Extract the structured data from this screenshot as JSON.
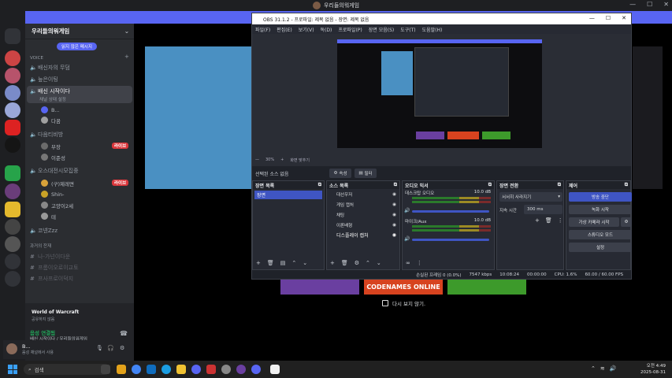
{
  "discord": {
    "window_title": "우리들의워게임",
    "server_name": "우리들의워게임",
    "unread_label": "읽지 않은 메시지",
    "voice_category": "Voice",
    "channels": [
      {
        "name": "배신자의 무덤"
      },
      {
        "name": "늪은이팅"
      },
      {
        "name": "배신 시작이다",
        "status": "채널 상태 설정"
      },
      {
        "name": "다음티비방"
      },
      {
        "name": "오스대전시모집중"
      },
      {
        "name": "코넨Zzz"
      }
    ],
    "past_category": "과거의 잔재",
    "past_channels": [
      "나-가넌이다운",
      "프롬이오로이교토",
      "프사프로이덕지"
    ],
    "users_ch3": [
      "B...",
      "다꿈"
    ],
    "users_ch4": [
      "부장",
      "이준성"
    ],
    "users_ch5": [
      "(구)제레면",
      "Shin-",
      "고양이2세",
      "테"
    ],
    "live_label": "라이브",
    "activity_game": "World of Warcraft",
    "activity_sub": "공유하지 않음",
    "voice_connected": "음성 연결됨",
    "voice_channel": "배신 시작이다 / 우리들의워게임",
    "self_name": "B...",
    "self_status": "음성 채널에서 사용"
  },
  "obs": {
    "title": "OBS 31.1.2 - 프로파일: 제목 없음 - 장면: 제목 없음",
    "menu": [
      "파일(F)",
      "편집(E)",
      "보기(V)",
      "독(D)",
      "프로파일(P)",
      "장면 모음(S)",
      "도구(T)",
      "도움말(H)"
    ],
    "zoom_label": "30%",
    "fit_label": "화면 맞추기",
    "no_source": "선택된 소스 없음",
    "props_btn": "속성",
    "filter_btn": "필터",
    "docks": {
      "scenes": "장면 목록",
      "sources": "소스 목록",
      "mixer": "오디오 믹서",
      "transitions": "장면 전환",
      "controls": "제어"
    },
    "scene_items": [
      "장면"
    ],
    "source_items": [
      "대선우저",
      "게임 캡처",
      "채팅",
      "이론배형",
      "디스플레이 캡처"
    ],
    "mixer_tracks": [
      {
        "name": "데스크탑 오디오",
        "db": "10.0 dB"
      },
      {
        "name": "마이크/Aux",
        "db": "10.0 dB"
      }
    ],
    "transition_type": "서서히 사라지기",
    "duration_label": "지속 시간",
    "duration_value": "300 ms",
    "control_buttons": [
      "방송 중단",
      "녹화 시작",
      "가상 카메라 시작",
      "스튜디오 모드",
      "설정"
    ],
    "status": {
      "dropped": "손실된 프레임 0 (0.0%)",
      "bitrate": "7547 kbps",
      "live_time": "10:08:24",
      "rec_time": "00:00:00",
      "cpu": "CPU: 1.6%",
      "fps": "60.00 / 60.00 FPS"
    }
  },
  "overlay": {
    "banner": "CODENAMES ONLINE",
    "dont_show": "다시 보지 않기."
  },
  "taskbar": {
    "search_placeholder": "검색",
    "time": "오전 4:49",
    "date": "2025-08-31"
  },
  "colors": {
    "discord_accent": "#5865f2",
    "obs_active": "#3f55c3",
    "live_red": "#da373c"
  }
}
